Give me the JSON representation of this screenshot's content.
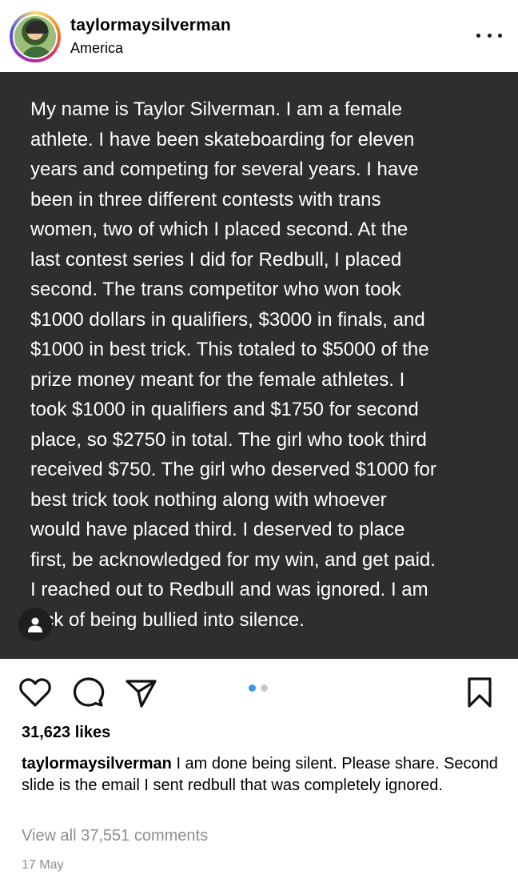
{
  "header": {
    "username": "taylormaysilverman",
    "location": "America",
    "more_icon": "more-horizontal-icon"
  },
  "post": {
    "text": "My name is Taylor Silverman. I am a female\nathlete. I have been skateboarding for eleven\nyears and competing for several years. I have\nbeen in three different contests with trans\nwomen, two of which I placed second. At the\nlast contest series I did for Redbull, I placed\nsecond. The trans competitor who won took\n$1000 dollars in qualifiers, $3000 in finals, and\n$1000 in best trick. This totaled to $5000 of the\nprize money meant for the female athletes. I\ntook $1000 in qualifiers and $1750 for second\nplace, so $2750 in total. The girl who took third\nreceived $750. The girl who deserved $1000 for\nbest trick took nothing along with whoever\nwould have placed third. I deserved to place\nfirst, be acknowledged for my win, and get paid.\nI reached out to Redbull and was ignored. I am\nsick of being bullied into silence.",
    "background": "#2e2e2e",
    "tag_icon": "user-tag-icon"
  },
  "actions": {
    "like_icon": "heart-icon",
    "comment_icon": "comment-icon",
    "share_icon": "send-icon",
    "save_icon": "bookmark-icon",
    "carousel": {
      "count": 2,
      "active": 1,
      "active_color": "#3897f0"
    }
  },
  "likes": "31,623 likes",
  "caption": {
    "username": "taylormaysilverman",
    "text": " I am done being silent. Please share. Second slide is the email I sent redbull that was completely ignored."
  },
  "view_comments": "View all 37,551 comments",
  "date": "17 May"
}
